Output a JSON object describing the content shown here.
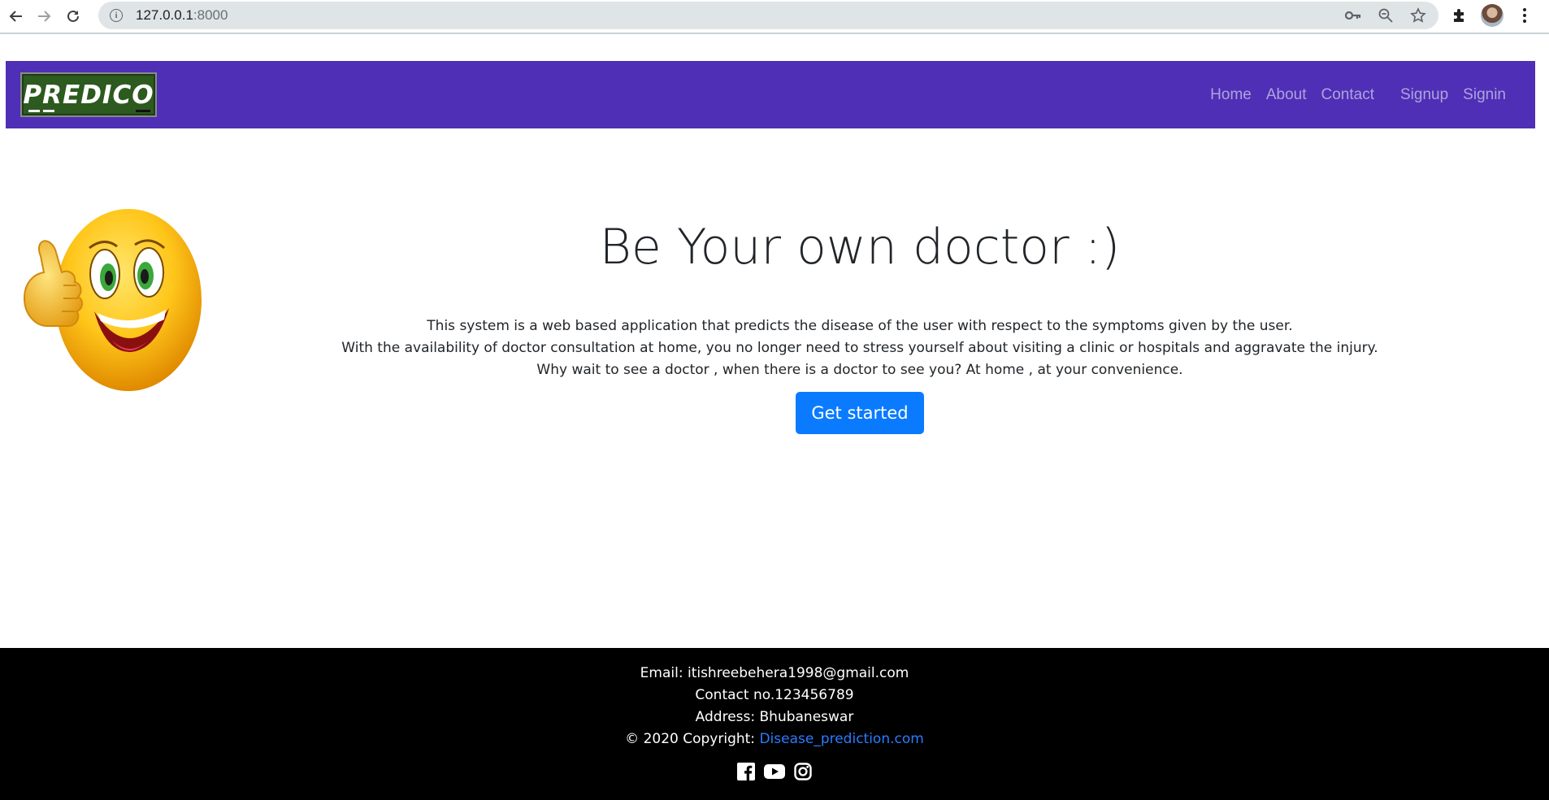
{
  "browser": {
    "url_host": "127.0.0.1",
    "url_port": ":8000"
  },
  "navbar": {
    "logo_text": "PREDICO",
    "links": [
      "Home",
      "About",
      "Contact",
      "Signup",
      "Signin"
    ]
  },
  "hero": {
    "title": "Be Your own doctor :)",
    "lines": [
      "This system is a web based application that predicts the disease of the user with respect to the symptoms given by the user.",
      "With the availability of doctor consultation at home, you no longer need to stress yourself about visiting a clinic or hospitals and aggravate the injury.",
      "Why wait to see a doctor , when there is a doctor to see you? At home , at your convenience."
    ],
    "button": "Get started"
  },
  "footer": {
    "email": "Email: itishreebehera1998@gmail.com",
    "contact": "Contact no.123456789",
    "address": "Address: Bhubaneswar",
    "copyright": "© 2020 Copyright: ",
    "site_link": "Disease_prediction.com"
  },
  "colors": {
    "navbar": "#4e2fb5",
    "button": "#0a7bff",
    "footer": "#000000",
    "link": "#2a7cff"
  },
  "icons": [
    "back-arrow-icon",
    "forward-arrow-icon",
    "reload-icon",
    "info-icon",
    "key-icon",
    "zoom-icon",
    "star-icon",
    "puzzle-icon",
    "profile-avatar",
    "menu-dots-icon",
    "facebook-icon",
    "youtube-icon",
    "instagram-icon"
  ]
}
